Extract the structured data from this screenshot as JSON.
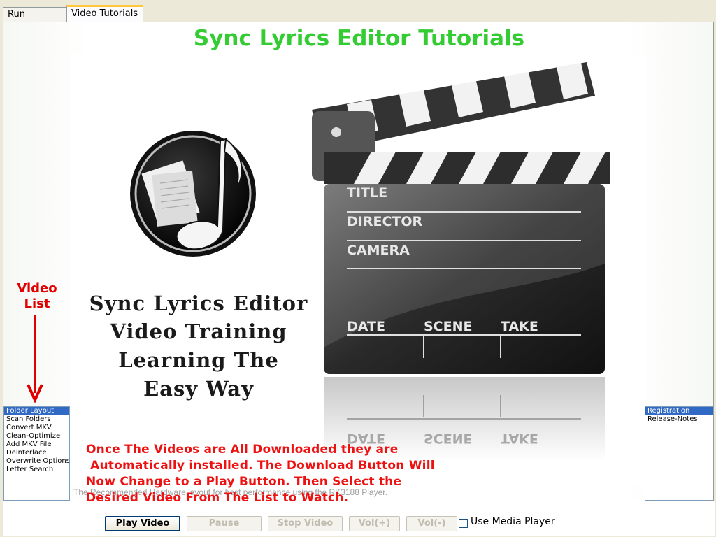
{
  "tabs": [
    {
      "label": "Run Window",
      "active": false
    },
    {
      "label": "Video Tutorials",
      "active": true
    }
  ],
  "heading": "Sync Lyrics Editor Tutorials",
  "banner": {
    "logo_lines": [
      "Sync Lyrics Editor",
      "Video Training",
      "Learning The",
      "Easy Way"
    ],
    "slate_labels": {
      "title": "TITLE",
      "director": "DIRECTOR",
      "camera": "CAMERA",
      "date": "DATE",
      "scene": "SCENE",
      "take": "TAKE"
    }
  },
  "video_list_label": [
    "Video",
    "List"
  ],
  "left_list": {
    "items": [
      "Folder Layout",
      "Scan Folders",
      "Convert MKV",
      "Clean-Optimize",
      "Add MKV File",
      "Deinterlace",
      "Overwrite Options",
      "Letter Search"
    ],
    "selected_index": 0
  },
  "right_list": {
    "items": [
      "Registration",
      "Release-Notes"
    ],
    "selected_index": 0
  },
  "status_text": "The Recommended Hardware layout for best performance using the RK3188 Player.",
  "overlay_lines": [
    "Once The Videos are All Downloaded they are",
    " Automatically installed. The Download Button Will",
    "Now Change to a Play Button. Then Select the",
    "Desired Video From The List to Watch."
  ],
  "buttons": {
    "play": "Play Video",
    "pause": "Pause",
    "stop": "Stop Video",
    "vol_up": "Vol(+)",
    "vol_down": "Vol(-)"
  },
  "use_media_player": {
    "label": "Use Media Player",
    "checked": false
  },
  "colors": {
    "heading": "#33cc33",
    "annotation": "#ee1111",
    "selection": "#316ac5",
    "tab_highlight": "#ffc83c"
  }
}
